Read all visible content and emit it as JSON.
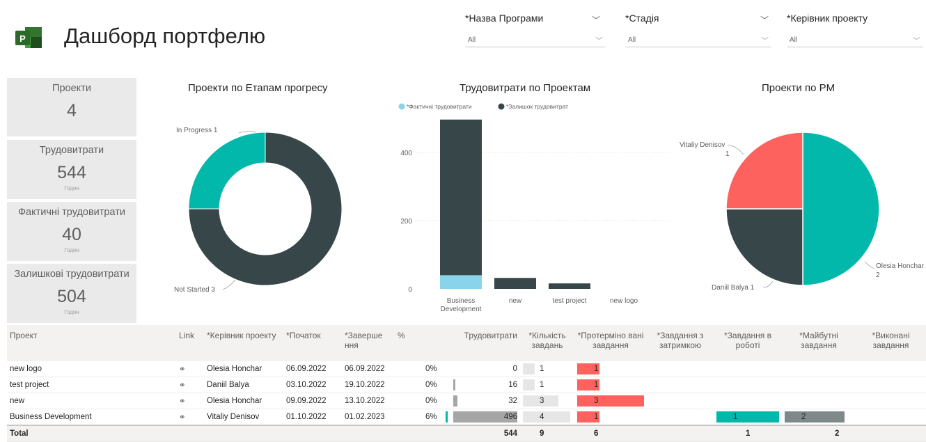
{
  "header": {
    "title": "Дашборд портфелю",
    "logo_icon": "project-logo-icon"
  },
  "filters": [
    {
      "label": "*Назва Програми",
      "value": "All"
    },
    {
      "label": "*Стадія",
      "value": "All"
    },
    {
      "label": "*Керівник проекту",
      "value": "All"
    }
  ],
  "cards": [
    {
      "title": "Проекти",
      "value": "4",
      "unit": ""
    },
    {
      "title": "Трудовитрати",
      "value": "544",
      "unit": "Годин"
    },
    {
      "title": "Фактичні трудовитрати",
      "value": "40",
      "unit": "Годин"
    },
    {
      "title": "Залишкові трудовитрати",
      "value": "504",
      "unit": "Годин"
    }
  ],
  "chart_data": [
    {
      "type": "pie",
      "title": "Проекти по Етапам прогресу",
      "donut": true,
      "categories": [
        "In Progress",
        "Not Started"
      ],
      "values": [
        1,
        3
      ],
      "labels": [
        "In Progress 1",
        "Not Started 3"
      ],
      "colors": [
        "#01b8aa",
        "#374649"
      ]
    },
    {
      "type": "bar",
      "stacked": true,
      "title": "Трудовитрати по Проектам",
      "categories": [
        "Business Development",
        "new",
        "test project",
        "new logo"
      ],
      "series": [
        {
          "name": "*Фактичні трудовитрати",
          "values": [
            40,
            0,
            0,
            0
          ],
          "color": "#8ad4eb"
        },
        {
          "name": "*Залишок трудовитрат",
          "values": [
            456,
            32,
            16,
            0
          ],
          "color": "#374649"
        }
      ],
      "yticks": [
        "0",
        "200",
        "400"
      ],
      "ylim": [
        0,
        520
      ],
      "legend": "top-left"
    },
    {
      "type": "pie",
      "title": "Проекти по PM",
      "categories": [
        "Olesia Honchar",
        "Daniil Balya",
        "Vitaliy Denisov"
      ],
      "values": [
        2,
        1,
        1
      ],
      "labels": [
        "Olesia Honchar\n2",
        "Daniil Balya 1",
        "Vitaliy Denisov\n1"
      ],
      "colors": [
        "#01b8aa",
        "#374649",
        "#fd625e"
      ]
    }
  ],
  "table": {
    "columns": [
      "Проект",
      "Link",
      "*Керівник проекту",
      "*Початок",
      "*Заверше ння",
      "%",
      "Трудовитрати",
      "*Кількість завдань",
      "*Протерміно вані завдання",
      "*Завдання з затримкою",
      "*Завдання в роботі",
      "*Майбутні завдання",
      "*Виконані завдання"
    ],
    "link_icon": "link-icon",
    "rows": [
      {
        "project": "new logo",
        "pm": "Olesia Honchar",
        "start": "06.09.2022",
        "end": "06.09.2022",
        "pct": "0%",
        "pct_value": 0,
        "work": "0",
        "work_value": 0,
        "tasks": "1",
        "tasks_value": 1,
        "overdue": "1",
        "overdue_value": 1,
        "delayed": "",
        "inprog": "",
        "inprog_value": 0,
        "future": "",
        "future_value": 0,
        "done": ""
      },
      {
        "project": "test project",
        "pm": "Daniil Balya",
        "start": "03.10.2022",
        "end": "19.10.2022",
        "pct": "0%",
        "pct_value": 0,
        "work": "16",
        "work_value": 16,
        "tasks": "1",
        "tasks_value": 1,
        "overdue": "1",
        "overdue_value": 1,
        "delayed": "",
        "inprog": "",
        "inprog_value": 0,
        "future": "",
        "future_value": 0,
        "done": ""
      },
      {
        "project": "new",
        "pm": "Olesia Honchar",
        "start": "09.09.2022",
        "end": "13.10.2022",
        "pct": "0%",
        "pct_value": 0,
        "work": "32",
        "work_value": 32,
        "tasks": "3",
        "tasks_value": 3,
        "overdue": "3",
        "overdue_value": 3,
        "delayed": "",
        "inprog": "",
        "inprog_value": 0,
        "future": "",
        "future_value": 0,
        "done": ""
      },
      {
        "project": "Business Development",
        "pm": "Vitaliy Denisov",
        "start": "01.10.2022",
        "end": "01.02.2023",
        "pct": "6%",
        "pct_value": 6,
        "work": "496",
        "work_value": 496,
        "tasks": "4",
        "tasks_value": 4,
        "overdue": "1",
        "overdue_value": 1,
        "delayed": "",
        "inprog": "1",
        "inprog_value": 1,
        "future": "2",
        "future_value": 2,
        "done": ""
      }
    ],
    "total": {
      "label": "Total",
      "work": "544",
      "tasks": "9",
      "overdue": "6",
      "inprog": "1",
      "future": "2"
    }
  },
  "colors": {
    "teal": "#01b8aa",
    "dark": "#374649",
    "red": "#fd625e",
    "lightblue": "#8ad4eb",
    "gray": "#a6a6a6",
    "lightgray": "#e6e6e6"
  }
}
